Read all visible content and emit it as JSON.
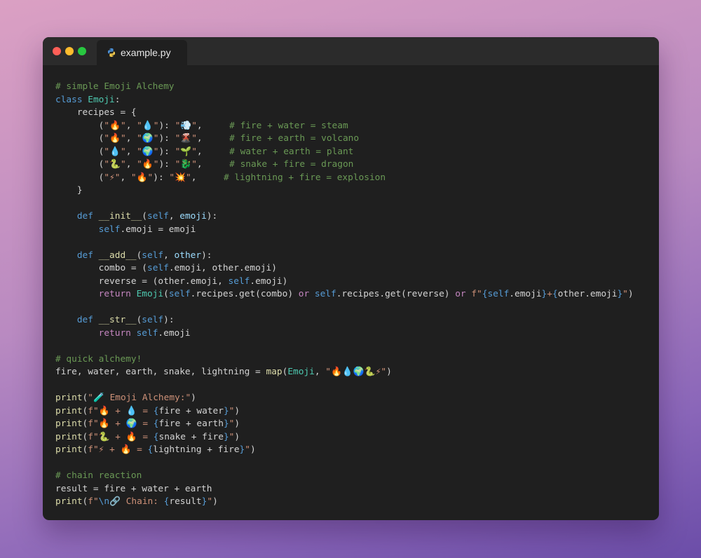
{
  "window": {
    "traffic_lights": {
      "close": "#ff5f57",
      "minimize": "#febc2e",
      "zoom": "#28c840"
    },
    "tab": {
      "label": "example.py",
      "icon": "python-icon"
    }
  },
  "code_lines": [
    [
      {
        "t": "comment",
        "s": "# simple Emoji Alchemy"
      }
    ],
    [
      {
        "t": "keyword",
        "s": "class "
      },
      {
        "t": "cls",
        "s": "Emoji"
      },
      {
        "t": "plain",
        "s": ":"
      }
    ],
    [
      {
        "t": "plain",
        "s": "    recipes = {"
      }
    ],
    [
      {
        "t": "plain",
        "s": "        ("
      },
      {
        "t": "string",
        "s": "\"🔥\""
      },
      {
        "t": "plain",
        "s": ", "
      },
      {
        "t": "string",
        "s": "\"💧\""
      },
      {
        "t": "plain",
        "s": "): "
      },
      {
        "t": "string",
        "s": "\"💨\""
      },
      {
        "t": "plain",
        "s": ",     "
      },
      {
        "t": "comment",
        "s": "# fire + water = steam"
      }
    ],
    [
      {
        "t": "plain",
        "s": "        ("
      },
      {
        "t": "string",
        "s": "\"🔥\""
      },
      {
        "t": "plain",
        "s": ", "
      },
      {
        "t": "string",
        "s": "\"🌍\""
      },
      {
        "t": "plain",
        "s": "): "
      },
      {
        "t": "string",
        "s": "\"🌋\""
      },
      {
        "t": "plain",
        "s": ",     "
      },
      {
        "t": "comment",
        "s": "# fire + earth = volcano"
      }
    ],
    [
      {
        "t": "plain",
        "s": "        ("
      },
      {
        "t": "string",
        "s": "\"💧\""
      },
      {
        "t": "plain",
        "s": ", "
      },
      {
        "t": "string",
        "s": "\"🌍\""
      },
      {
        "t": "plain",
        "s": "): "
      },
      {
        "t": "string",
        "s": "\"🌱\""
      },
      {
        "t": "plain",
        "s": ",     "
      },
      {
        "t": "comment",
        "s": "# water + earth = plant"
      }
    ],
    [
      {
        "t": "plain",
        "s": "        ("
      },
      {
        "t": "string",
        "s": "\"🐍\""
      },
      {
        "t": "plain",
        "s": ", "
      },
      {
        "t": "string",
        "s": "\"🔥\""
      },
      {
        "t": "plain",
        "s": "): "
      },
      {
        "t": "string",
        "s": "\"🐉\""
      },
      {
        "t": "plain",
        "s": ",     "
      },
      {
        "t": "comment",
        "s": "# snake + fire = dragon"
      }
    ],
    [
      {
        "t": "plain",
        "s": "        ("
      },
      {
        "t": "string",
        "s": "\"⚡\""
      },
      {
        "t": "plain",
        "s": ", "
      },
      {
        "t": "string",
        "s": "\"🔥\""
      },
      {
        "t": "plain",
        "s": "): "
      },
      {
        "t": "string",
        "s": "\"💥\""
      },
      {
        "t": "plain",
        "s": ",     "
      },
      {
        "t": "comment",
        "s": "# lightning + fire = explosion"
      }
    ],
    [
      {
        "t": "plain",
        "s": "    }"
      }
    ],
    [],
    [
      {
        "t": "keyword",
        "s": "    def "
      },
      {
        "t": "func",
        "s": "__init__"
      },
      {
        "t": "plain",
        "s": "("
      },
      {
        "t": "self",
        "s": "self"
      },
      {
        "t": "plain",
        "s": ", "
      },
      {
        "t": "param",
        "s": "emoji"
      },
      {
        "t": "plain",
        "s": "):"
      }
    ],
    [
      {
        "t": "self",
        "s": "        self"
      },
      {
        "t": "plain",
        "s": ".emoji = emoji"
      }
    ],
    [],
    [
      {
        "t": "keyword",
        "s": "    def "
      },
      {
        "t": "func",
        "s": "__add__"
      },
      {
        "t": "plain",
        "s": "("
      },
      {
        "t": "self",
        "s": "self"
      },
      {
        "t": "plain",
        "s": ", "
      },
      {
        "t": "param",
        "s": "other"
      },
      {
        "t": "plain",
        "s": "):"
      }
    ],
    [
      {
        "t": "plain",
        "s": "        combo = ("
      },
      {
        "t": "self",
        "s": "self"
      },
      {
        "t": "plain",
        "s": ".emoji, other.emoji)"
      }
    ],
    [
      {
        "t": "plain",
        "s": "        reverse = (other.emoji, "
      },
      {
        "t": "self",
        "s": "self"
      },
      {
        "t": "plain",
        "s": ".emoji)"
      }
    ],
    [
      {
        "t": "ctrl",
        "s": "        return "
      },
      {
        "t": "cls",
        "s": "Emoji"
      },
      {
        "t": "plain",
        "s": "("
      },
      {
        "t": "self",
        "s": "self"
      },
      {
        "t": "plain",
        "s": ".recipes.get(combo) "
      },
      {
        "t": "ctrl",
        "s": "or "
      },
      {
        "t": "self",
        "s": "self"
      },
      {
        "t": "plain",
        "s": ".recipes.get(reverse) "
      },
      {
        "t": "ctrl",
        "s": "or "
      },
      {
        "t": "string",
        "s": "f\""
      },
      {
        "t": "brace",
        "s": "{"
      },
      {
        "t": "self",
        "s": "self"
      },
      {
        "t": "plain",
        "s": ".emoji"
      },
      {
        "t": "brace",
        "s": "}"
      },
      {
        "t": "string",
        "s": "+"
      },
      {
        "t": "brace",
        "s": "{"
      },
      {
        "t": "plain",
        "s": "other.emoji"
      },
      {
        "t": "brace",
        "s": "}"
      },
      {
        "t": "string",
        "s": "\""
      },
      {
        "t": "plain",
        "s": ")"
      }
    ],
    [],
    [
      {
        "t": "keyword",
        "s": "    def "
      },
      {
        "t": "func",
        "s": "__str__"
      },
      {
        "t": "plain",
        "s": "("
      },
      {
        "t": "self",
        "s": "self"
      },
      {
        "t": "plain",
        "s": "):"
      }
    ],
    [
      {
        "t": "ctrl",
        "s": "        return "
      },
      {
        "t": "self",
        "s": "self"
      },
      {
        "t": "plain",
        "s": ".emoji"
      }
    ],
    [],
    [
      {
        "t": "comment",
        "s": "# quick alchemy!"
      }
    ],
    [
      {
        "t": "plain",
        "s": "fire, water, earth, snake, lightning = "
      },
      {
        "t": "func",
        "s": "map"
      },
      {
        "t": "plain",
        "s": "("
      },
      {
        "t": "cls",
        "s": "Emoji"
      },
      {
        "t": "plain",
        "s": ", "
      },
      {
        "t": "string",
        "s": "\"🔥💧🌍🐍⚡\""
      },
      {
        "t": "plain",
        "s": ")"
      }
    ],
    [],
    [
      {
        "t": "func",
        "s": "print"
      },
      {
        "t": "plain",
        "s": "("
      },
      {
        "t": "string",
        "s": "\"🧪 Emoji Alchemy:\""
      },
      {
        "t": "plain",
        "s": ")"
      }
    ],
    [
      {
        "t": "func",
        "s": "print"
      },
      {
        "t": "plain",
        "s": "("
      },
      {
        "t": "string",
        "s": "f\"🔥 + 💧 = "
      },
      {
        "t": "brace",
        "s": "{"
      },
      {
        "t": "plain",
        "s": "fire + water"
      },
      {
        "t": "brace",
        "s": "}"
      },
      {
        "t": "string",
        "s": "\""
      },
      {
        "t": "plain",
        "s": ")"
      }
    ],
    [
      {
        "t": "func",
        "s": "print"
      },
      {
        "t": "plain",
        "s": "("
      },
      {
        "t": "string",
        "s": "f\"🔥 + 🌍 = "
      },
      {
        "t": "brace",
        "s": "{"
      },
      {
        "t": "plain",
        "s": "fire + earth"
      },
      {
        "t": "brace",
        "s": "}"
      },
      {
        "t": "string",
        "s": "\""
      },
      {
        "t": "plain",
        "s": ")"
      }
    ],
    [
      {
        "t": "func",
        "s": "print"
      },
      {
        "t": "plain",
        "s": "("
      },
      {
        "t": "string",
        "s": "f\"🐍 + 🔥 = "
      },
      {
        "t": "brace",
        "s": "{"
      },
      {
        "t": "plain",
        "s": "snake + fire"
      },
      {
        "t": "brace",
        "s": "}"
      },
      {
        "t": "string",
        "s": "\""
      },
      {
        "t": "plain",
        "s": ")"
      }
    ],
    [
      {
        "t": "func",
        "s": "print"
      },
      {
        "t": "plain",
        "s": "("
      },
      {
        "t": "string",
        "s": "f\"⚡ + 🔥 = "
      },
      {
        "t": "brace",
        "s": "{"
      },
      {
        "t": "plain",
        "s": "lightning + fire"
      },
      {
        "t": "brace",
        "s": "}"
      },
      {
        "t": "string",
        "s": "\""
      },
      {
        "t": "plain",
        "s": ")"
      }
    ],
    [],
    [
      {
        "t": "comment",
        "s": "# chain reaction"
      }
    ],
    [
      {
        "t": "plain",
        "s": "result = fire + water + earth"
      }
    ],
    [
      {
        "t": "func",
        "s": "print"
      },
      {
        "t": "plain",
        "s": "("
      },
      {
        "t": "string",
        "s": "f\""
      },
      {
        "t": "brace",
        "s": "\\n"
      },
      {
        "t": "string",
        "s": "🔗 Chain: "
      },
      {
        "t": "brace",
        "s": "{"
      },
      {
        "t": "plain",
        "s": "result"
      },
      {
        "t": "brace",
        "s": "}"
      },
      {
        "t": "string",
        "s": "\""
      },
      {
        "t": "plain",
        "s": ")"
      }
    ]
  ]
}
